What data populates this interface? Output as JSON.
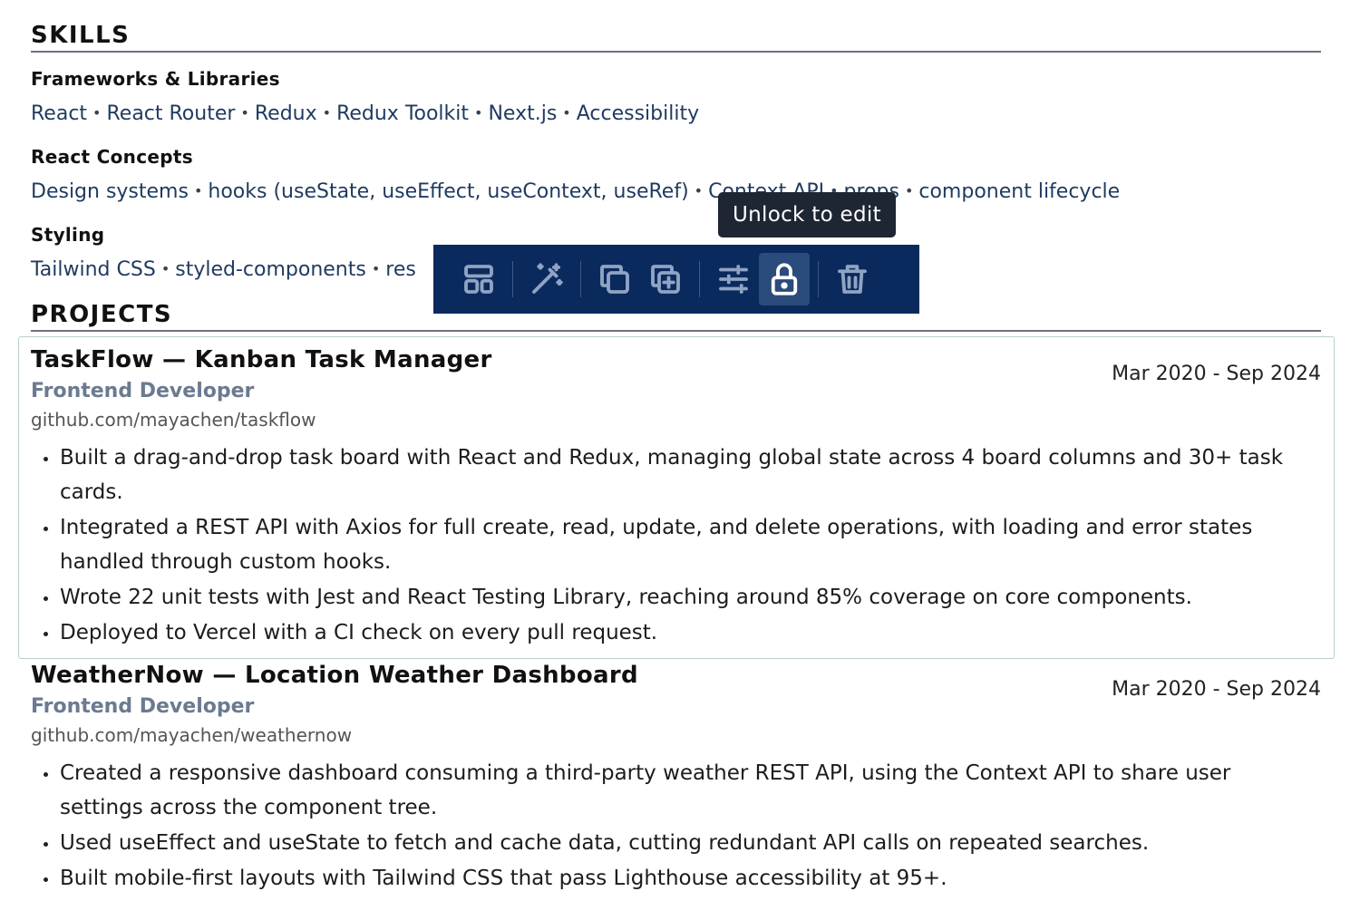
{
  "skills": {
    "title": "SKILLS",
    "groups": [
      {
        "label": "Frameworks & Libraries",
        "items": [
          "React",
          "React Router",
          "Redux",
          "Redux Toolkit",
          "Next.js",
          "Accessibility"
        ]
      },
      {
        "label": "React Concepts",
        "items": [
          "Design systems",
          "hooks (useState, useEffect, useContext, useRef)",
          "Context API",
          "props",
          "component lifecycle"
        ]
      },
      {
        "label": "Styling",
        "items": [
          "Tailwind CSS",
          "styled-components",
          "res"
        ]
      }
    ]
  },
  "projects": {
    "title": "PROJECTS",
    "items": [
      {
        "title": "TaskFlow — Kanban Task Manager",
        "role": "Frontend Developer",
        "link": "github.com/mayachen/taskflow",
        "date": "Mar 2020 - Sep 2024",
        "bullets": [
          "Built a drag-and-drop task board with React and Redux, managing global state across 4 board columns and 30+ task cards.",
          "Integrated a REST API with Axios for full create, read, update, and delete operations, with loading and error states handled through custom hooks.",
          "Wrote 22 unit tests with Jest and React Testing Library, reaching around 85% coverage on core components.",
          "Deployed to Vercel with a CI check on every pull request."
        ]
      },
      {
        "title": "WeatherNow — Location Weather Dashboard",
        "role": "Frontend Developer",
        "link": "github.com/mayachen/weathernow",
        "date": "Mar 2020 - Sep 2024",
        "bullets": [
          "Created a responsive dashboard consuming a third-party weather REST API, using the Context API to share user settings across the component tree.",
          "Used useEffect and useState to fetch and cache data, cutting redundant API calls on repeated searches.",
          "Built mobile-first layouts with Tailwind CSS that pass Lighthouse accessibility at 95+."
        ]
      }
    ]
  },
  "toolbar": {
    "tooltip": "Unlock to edit",
    "buttons": [
      "layout-icon",
      "magic-wand-icon",
      "copy-icon",
      "duplicate-icon",
      "sliders-icon",
      "lock-icon",
      "trash-icon"
    ],
    "active": "lock-icon"
  },
  "colors": {
    "toolbar_bg": "#0a2a5e",
    "accent_text": "#1f3a5f",
    "role_text": "#6b7a90",
    "selection_border": "#b8d0cc"
  }
}
